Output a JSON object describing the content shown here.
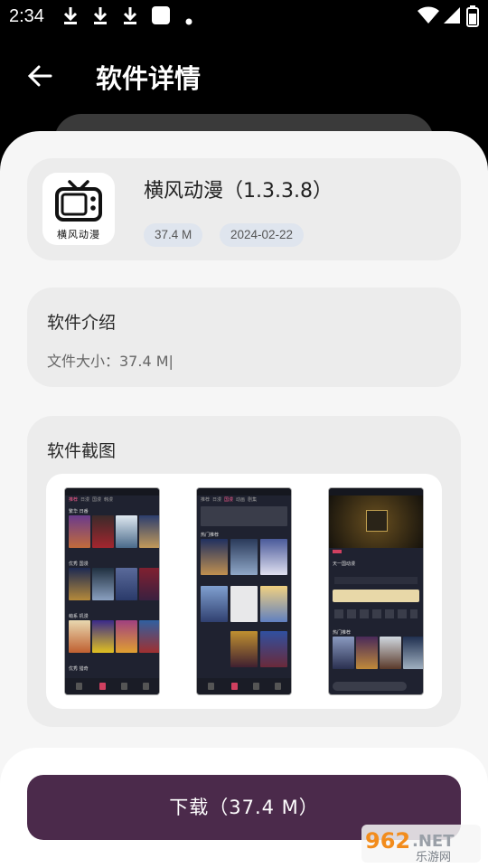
{
  "status_bar": {
    "time": "2:34",
    "notification_icons": [
      "download-icon",
      "download-icon",
      "download-icon",
      "app-square-icon",
      "dot-icon"
    ],
    "system_icons": [
      "wifi-icon",
      "signal-icon",
      "battery-icon"
    ]
  },
  "app_bar": {
    "title": "软件详情",
    "back_icon": "arrow-back-icon"
  },
  "app_info": {
    "icon_label": "横风动漫",
    "name": "横风动漫（1.3.3.8）",
    "size": "37.4 M",
    "date": "2024-02-22"
  },
  "intro": {
    "heading": "软件介绍",
    "body": "文件大小：37.4 M|"
  },
  "screenshots": {
    "heading": "软件截图",
    "items": [
      {
        "tabs": [
          "推荐",
          "日漫",
          "国漫",
          "韩漫"
        ],
        "sections": [
          "繁华 日番",
          "优秀 国漫",
          "萌系 机漫",
          "优秀 猎奇"
        ]
      },
      {
        "tabs": [
          "推荐",
          "日漫",
          "国漫",
          "动画",
          "剧集"
        ],
        "sections": [
          "热门推荐"
        ]
      },
      {
        "tabs": [],
        "sections": [
          "天一国动漫",
          "热门推荐"
        ]
      }
    ]
  },
  "download": {
    "label": "下载（37.4 M）"
  },
  "colors": {
    "accent": "#4b2a4b",
    "chip_bg": "#dfe5ee",
    "card_bg": "#ececec",
    "sheet_bg": "#f6f6f6"
  }
}
